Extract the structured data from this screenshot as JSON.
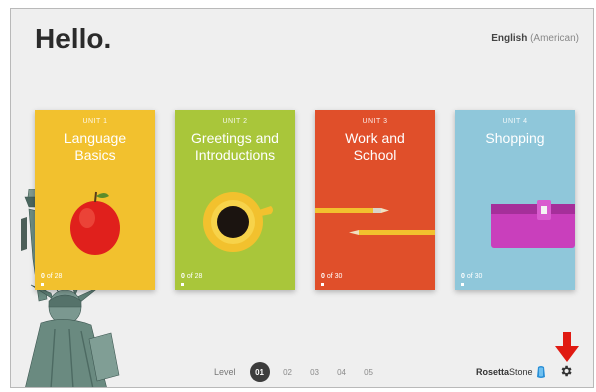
{
  "header": {
    "greeting": "Hello.",
    "language_main": "English",
    "language_sub": "(American)"
  },
  "units": [
    {
      "label": "UNIT 1",
      "title_line1": "Language",
      "title_line2": "Basics",
      "progress_done": "0",
      "progress_total": "of 28",
      "color": "#f2c12e",
      "illustration": "apple-icon"
    },
    {
      "label": "UNIT 2",
      "title_line1": "Greetings and",
      "title_line2": "Introductions",
      "progress_done": "0",
      "progress_total": "of 28",
      "color": "#a9c63a",
      "illustration": "coffee-cup-icon"
    },
    {
      "label": "UNIT 3",
      "title_line1": "Work and",
      "title_line2": "School",
      "progress_done": "0",
      "progress_total": "of 30",
      "color": "#e04f2a",
      "illustration": "pencils-icon"
    },
    {
      "label": "UNIT 4",
      "title_line1": "Shopping",
      "title_line2": "",
      "progress_done": "0",
      "progress_total": "of 30",
      "color": "#8fc7da",
      "illustration": "wallet-icon"
    }
  ],
  "levels": {
    "label": "Level",
    "items": [
      "01",
      "02",
      "03",
      "04",
      "05"
    ],
    "active": "01"
  },
  "brand": {
    "name_bold": "Rosetta",
    "name_regular": "Stone"
  },
  "colors": {
    "arrow": "#e01a12",
    "level_active": "#3c3c3c",
    "background": "#efefef"
  }
}
